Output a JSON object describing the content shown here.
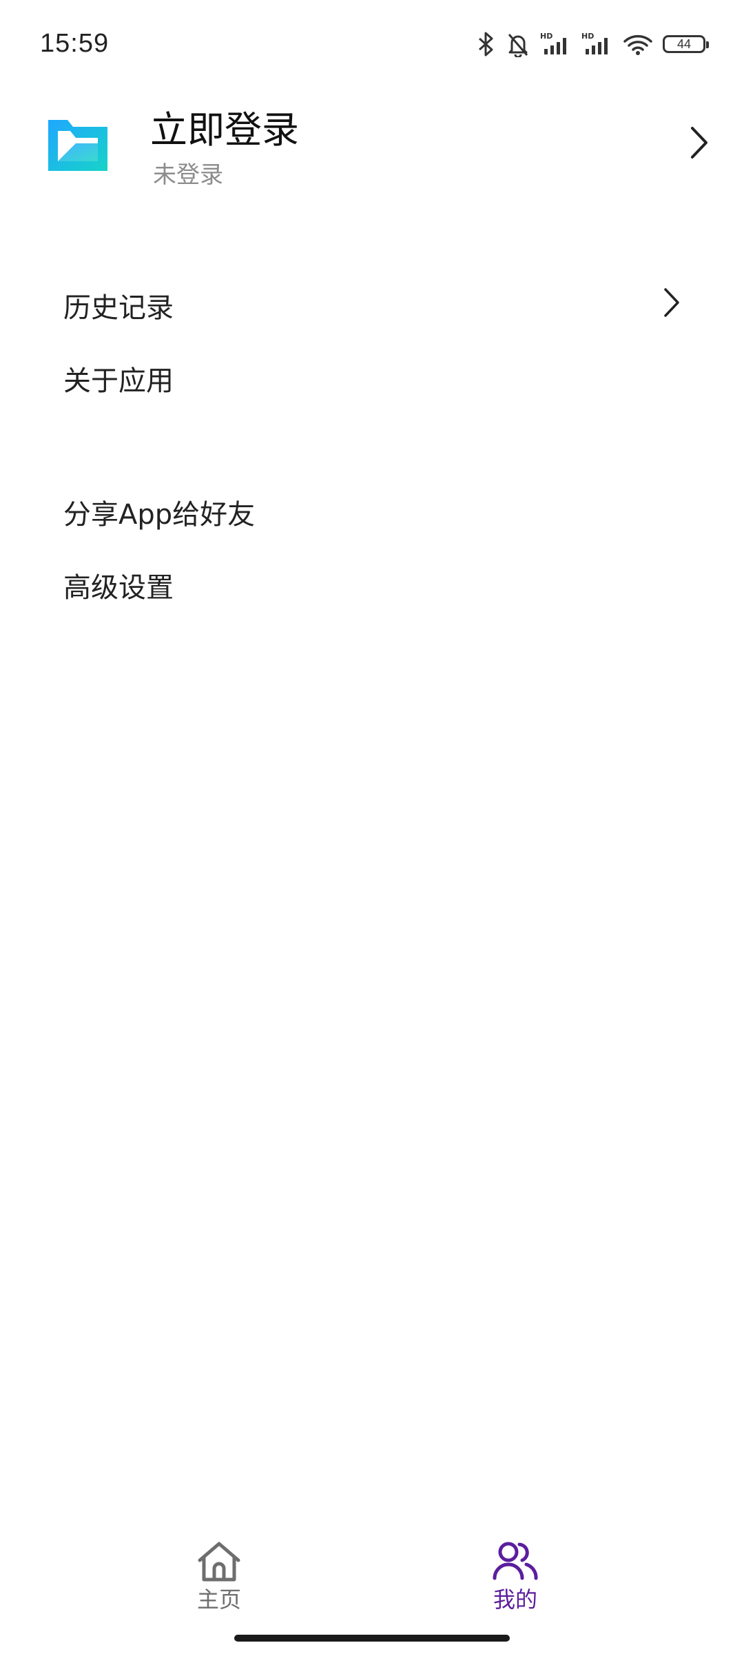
{
  "status_bar": {
    "time": "15:59",
    "battery_level": "44",
    "icons": [
      "bluetooth-icon",
      "mute-bell-icon",
      "signal-hd-icon",
      "signal-hd-icon",
      "wifi-icon",
      "battery-icon"
    ]
  },
  "profile": {
    "title": "立即登录",
    "subtitle": "未登录",
    "logo_color": "#00b4e8"
  },
  "menu": {
    "group1": {
      "history": "历史记录",
      "about": "关于应用"
    },
    "group2": {
      "share": "分享App给好友",
      "advanced": "高级设置"
    }
  },
  "tabs": {
    "home": "主页",
    "mine": "我的"
  },
  "colors": {
    "accent": "#5b1e9e",
    "inactive": "#6e6e6e"
  }
}
